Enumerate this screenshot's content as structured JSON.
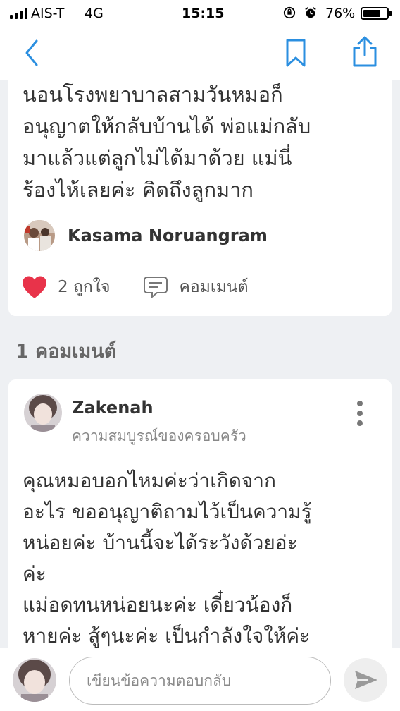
{
  "status_bar": {
    "carrier": "AIS-T",
    "network": "4G",
    "time": "15:15",
    "battery_percent": "76%",
    "battery_level": 0.76
  },
  "nav": {
    "back_icon": "chevron-left-icon",
    "bookmark_icon": "bookmark-icon",
    "share_icon": "share-icon",
    "accent_color": "#2b8fe0"
  },
  "post": {
    "body": "นอนโรงพยาบาลสามวันหมอก็\nอนุญาตให้กลับบ้านได้ พ่อแม่กลับ\nมาแล้วแต่ลูกไม่ได้มาด้วย แม่นี่\nร้องไห้เลยค่ะ คิดถึงลูกมาก",
    "author": "Kasama Noruangram",
    "like_label": "2 ถูกใจ",
    "comment_label": "คอมเมนต์",
    "heart_color": "#e8334a"
  },
  "comments": {
    "count_label": "1 คอมเมนต์",
    "items": [
      {
        "name": "Zakenah",
        "subtitle": "ความสมบูรณ์ของครอบครัว",
        "text": "คุณหมอบอกไหมค่ะว่าเกิดจาก\nอะไร ขออนุญาติถามไว้เป็นความรู้\nหน่อยค่ะ บ้านนี้จะได้ระวังด้วยอ่ะ\nค่ะ\nแม่อดทนหน่อยนะค่ะ เดี๋ยวน้องก็\nหายค่ะ สู้ๆนะค่ะ เป็นกำลังใจให้ค่ะ"
      }
    ]
  },
  "reply": {
    "placeholder": "เขียนข้อความตอบกลับ",
    "send_icon": "send-icon"
  }
}
